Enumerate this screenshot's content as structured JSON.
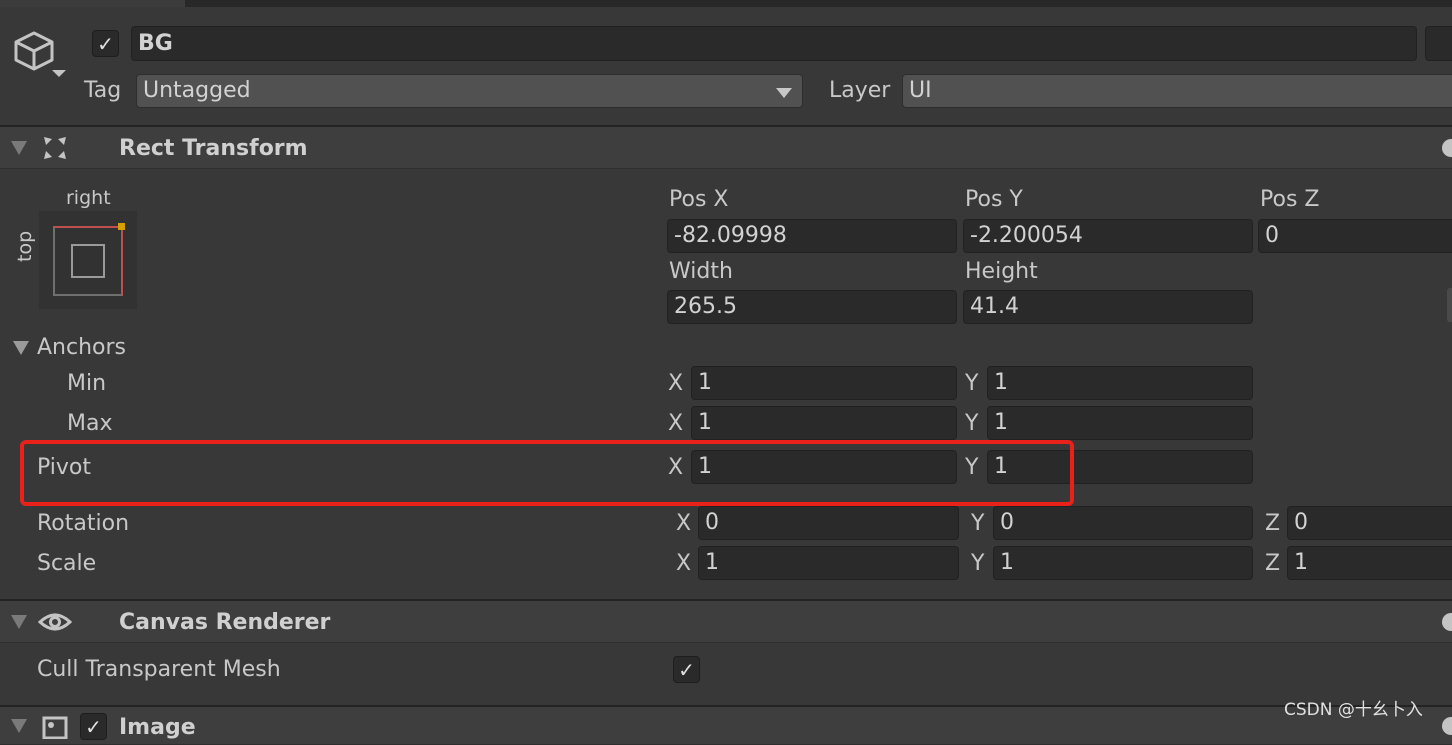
{
  "object": {
    "active": true,
    "name": "BG",
    "tag_label": "Tag",
    "tag_value": "Untagged",
    "layer_label": "Layer",
    "layer_value": "UI"
  },
  "rect_transform": {
    "title": "Rect Transform",
    "anchor_preset": {
      "horizontal": "right",
      "vertical": "top"
    },
    "pos_x_label": "Pos X",
    "pos_x": "-82.09998",
    "pos_y_label": "Pos Y",
    "pos_y": "-2.200054",
    "pos_z_label": "Pos Z",
    "pos_z": "0",
    "width_label": "Width",
    "width": "265.5",
    "height_label": "Height",
    "height": "41.4",
    "anchors_label": "Anchors",
    "min_label": "Min",
    "min_x": "1",
    "min_y": "1",
    "max_label": "Max",
    "max_x": "1",
    "max_y": "1",
    "pivot_label": "Pivot",
    "pivot_x": "1",
    "pivot_y": "1",
    "rotation_label": "Rotation",
    "rot_x": "0",
    "rot_y": "0",
    "rot_z": "0",
    "scale_label": "Scale",
    "scale_x": "1",
    "scale_y": "1",
    "scale_z": "1",
    "x": "X",
    "y": "Y",
    "z": "Z"
  },
  "canvas_renderer": {
    "title": "Canvas Renderer",
    "cull_label": "Cull Transparent Mesh",
    "cull_checked": true
  },
  "image": {
    "title": "Image",
    "enabled": true
  },
  "highlight_color": "#e8221b",
  "watermark": "CSDN @十幺卜入"
}
